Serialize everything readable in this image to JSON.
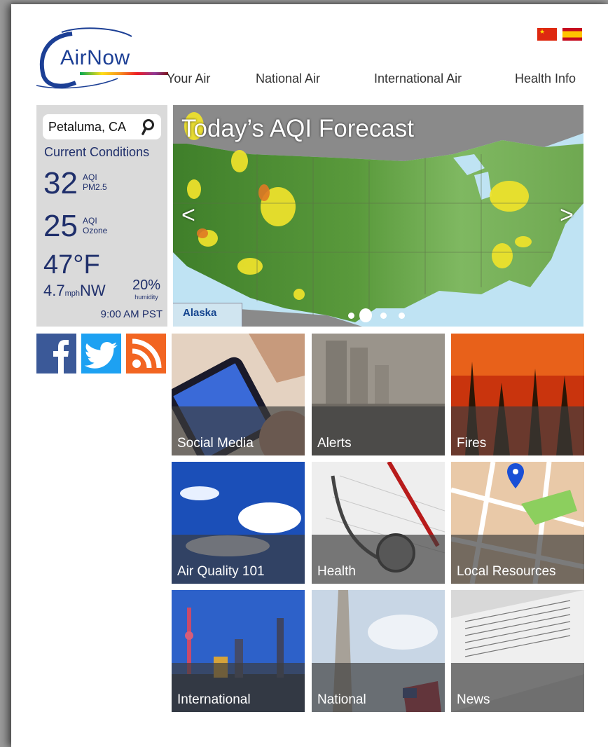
{
  "header": {
    "logo_text": "AirNow",
    "nav": [
      "Your Air",
      "National Air",
      "International Air",
      "Health Info"
    ],
    "flags": [
      "china-flag",
      "spain-flag"
    ]
  },
  "conditions": {
    "location": "Petaluma, CA",
    "heading": "Current Conditions",
    "pm25_value": "32",
    "pm25_unit_line1": "AQI",
    "pm25_unit_line2": "PM2.5",
    "ozone_value": "25",
    "ozone_unit_line1": "AQI",
    "ozone_unit_line2": "Ozone",
    "temperature": "47°F",
    "wind_speed": "4.7",
    "wind_unit": "mph",
    "wind_dir": "NW",
    "humidity": "20%",
    "humidity_label": "humidity",
    "time": "9:00 AM PST"
  },
  "social": [
    "facebook-icon",
    "twitter-icon",
    "rss-icon"
  ],
  "map": {
    "title": "Today’s AQI Forecast",
    "inset_label": "Alaska",
    "prev": "<",
    "next": ">",
    "slide_count": 4,
    "active_slide": 2
  },
  "tiles": [
    {
      "label": "Social Media"
    },
    {
      "label": "Alerts"
    },
    {
      "label": "Fires"
    },
    {
      "label": "Air Quality 101"
    },
    {
      "label": "Health"
    },
    {
      "label": "Local Resources"
    },
    {
      "label": "International"
    },
    {
      "label": "National"
    },
    {
      "label": "News"
    }
  ],
  "colors": {
    "brand_blue": "#1c3f95",
    "panel_gray": "#dadada",
    "aqi_yellow": "#f0e32b",
    "aqi_orange": "#e07a24",
    "facebook": "#3b5998",
    "twitter": "#1da1f2",
    "rss": "#f26522"
  }
}
